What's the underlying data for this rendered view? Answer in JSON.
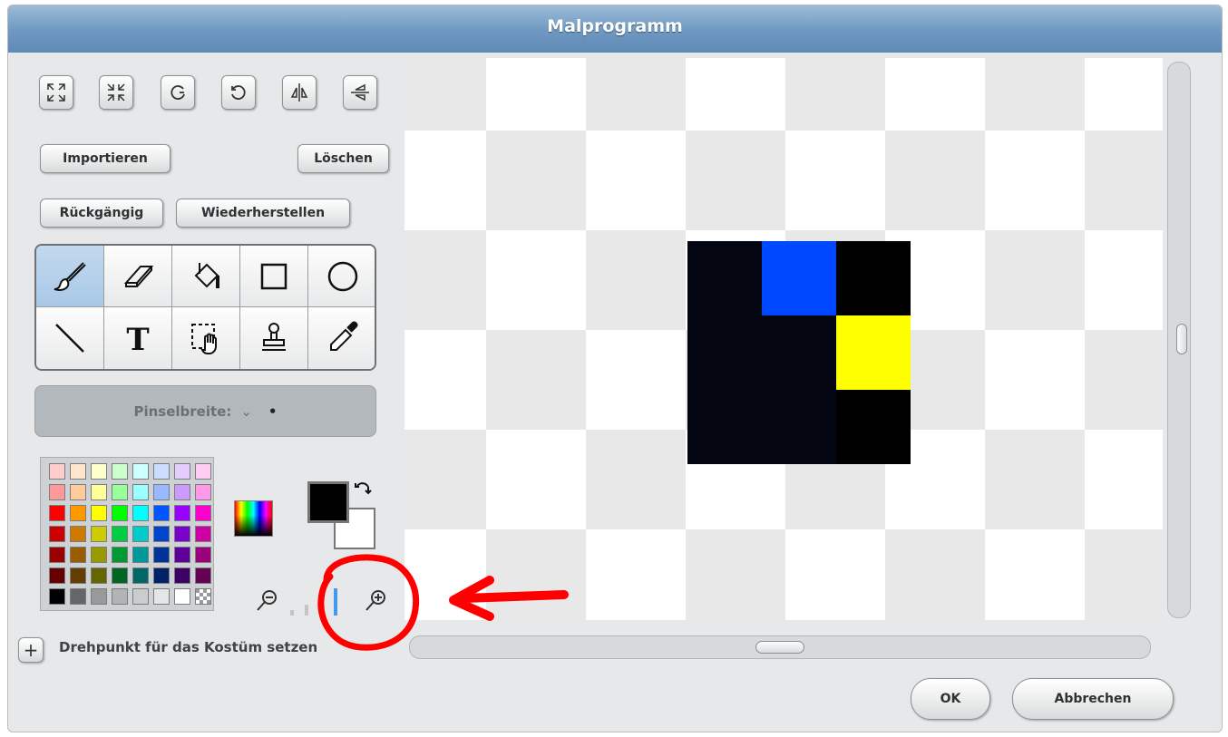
{
  "window": {
    "title": "Malprogramm"
  },
  "toolbar": {
    "icons": [
      "grow-icon",
      "shrink-icon",
      "rotate-left-icon",
      "rotate-right-icon",
      "flip-horizontal-icon",
      "flip-vertical-icon"
    ]
  },
  "actions": {
    "import_label": "Importieren",
    "clear_label": "Löschen",
    "undo_label": "Rückgängig",
    "redo_label": "Wiederherstellen"
  },
  "tools": {
    "selected": "paintbrush",
    "items": [
      "paintbrush",
      "eraser",
      "fill",
      "rectangle",
      "ellipse",
      "line",
      "text",
      "select",
      "stamp",
      "eyedropper"
    ]
  },
  "brush": {
    "label": "Pinselbreite:",
    "chevron": "⌄",
    "dot": "•"
  },
  "colors": {
    "palette": [
      [
        "#ffcccc",
        "#ffe5cc",
        "#ffffcc",
        "#ccffcc",
        "#ccffff",
        "#ccdcff",
        "#e5ccff",
        "#ffccf2"
      ],
      [
        "#ff9999",
        "#ffcc99",
        "#ffff99",
        "#99ff99",
        "#99ffff",
        "#99b8ff",
        "#cc99ff",
        "#ff99e5"
      ],
      [
        "#ff0000",
        "#ff9900",
        "#ffff00",
        "#00ff00",
        "#00ffff",
        "#0055ff",
        "#9900ff",
        "#ff00cc"
      ],
      [
        "#cc0000",
        "#cc7a00",
        "#cccc00",
        "#00cc44",
        "#00cccc",
        "#0044cc",
        "#7a00cc",
        "#cc00a3"
      ],
      [
        "#990000",
        "#995c00",
        "#999900",
        "#009933",
        "#009999",
        "#003399",
        "#5c0099",
        "#99007a"
      ],
      [
        "#660000",
        "#663d00",
        "#666600",
        "#006622",
        "#006666",
        "#002266",
        "#3d0066",
        "#660052"
      ],
      [
        "#000000",
        "#666666",
        "#999999",
        "#b3b3b3",
        "#cccccc",
        "#e6e6e6",
        "#ffffff",
        "transparent"
      ]
    ],
    "primary": "#000000",
    "secondary": "#ffffff"
  },
  "zoom": {
    "levels": 4,
    "active_level": 4
  },
  "canvas": {
    "pixels": [
      {
        "col": 0,
        "row": 0,
        "color": "#030610"
      },
      {
        "col": 1,
        "row": 0,
        "color": "#0048ff"
      },
      {
        "col": 2,
        "row": 0,
        "color": "#000000"
      },
      {
        "col": 0,
        "row": 1,
        "color": "#030610"
      },
      {
        "col": 1,
        "row": 1,
        "color": "#030610"
      },
      {
        "col": 2,
        "row": 1,
        "color": "#ffff00"
      },
      {
        "col": 0,
        "row": 2,
        "color": "#030610"
      },
      {
        "col": 1,
        "row": 2,
        "color": "#030610"
      },
      {
        "col": 2,
        "row": 2,
        "color": "#000000"
      }
    ]
  },
  "pivot": {
    "label": "Drehpunkt für das Kostüm setzen"
  },
  "footer": {
    "ok_label": "OK",
    "cancel_label": "Abbrechen"
  },
  "annotation": {
    "color": "#ff0000"
  }
}
